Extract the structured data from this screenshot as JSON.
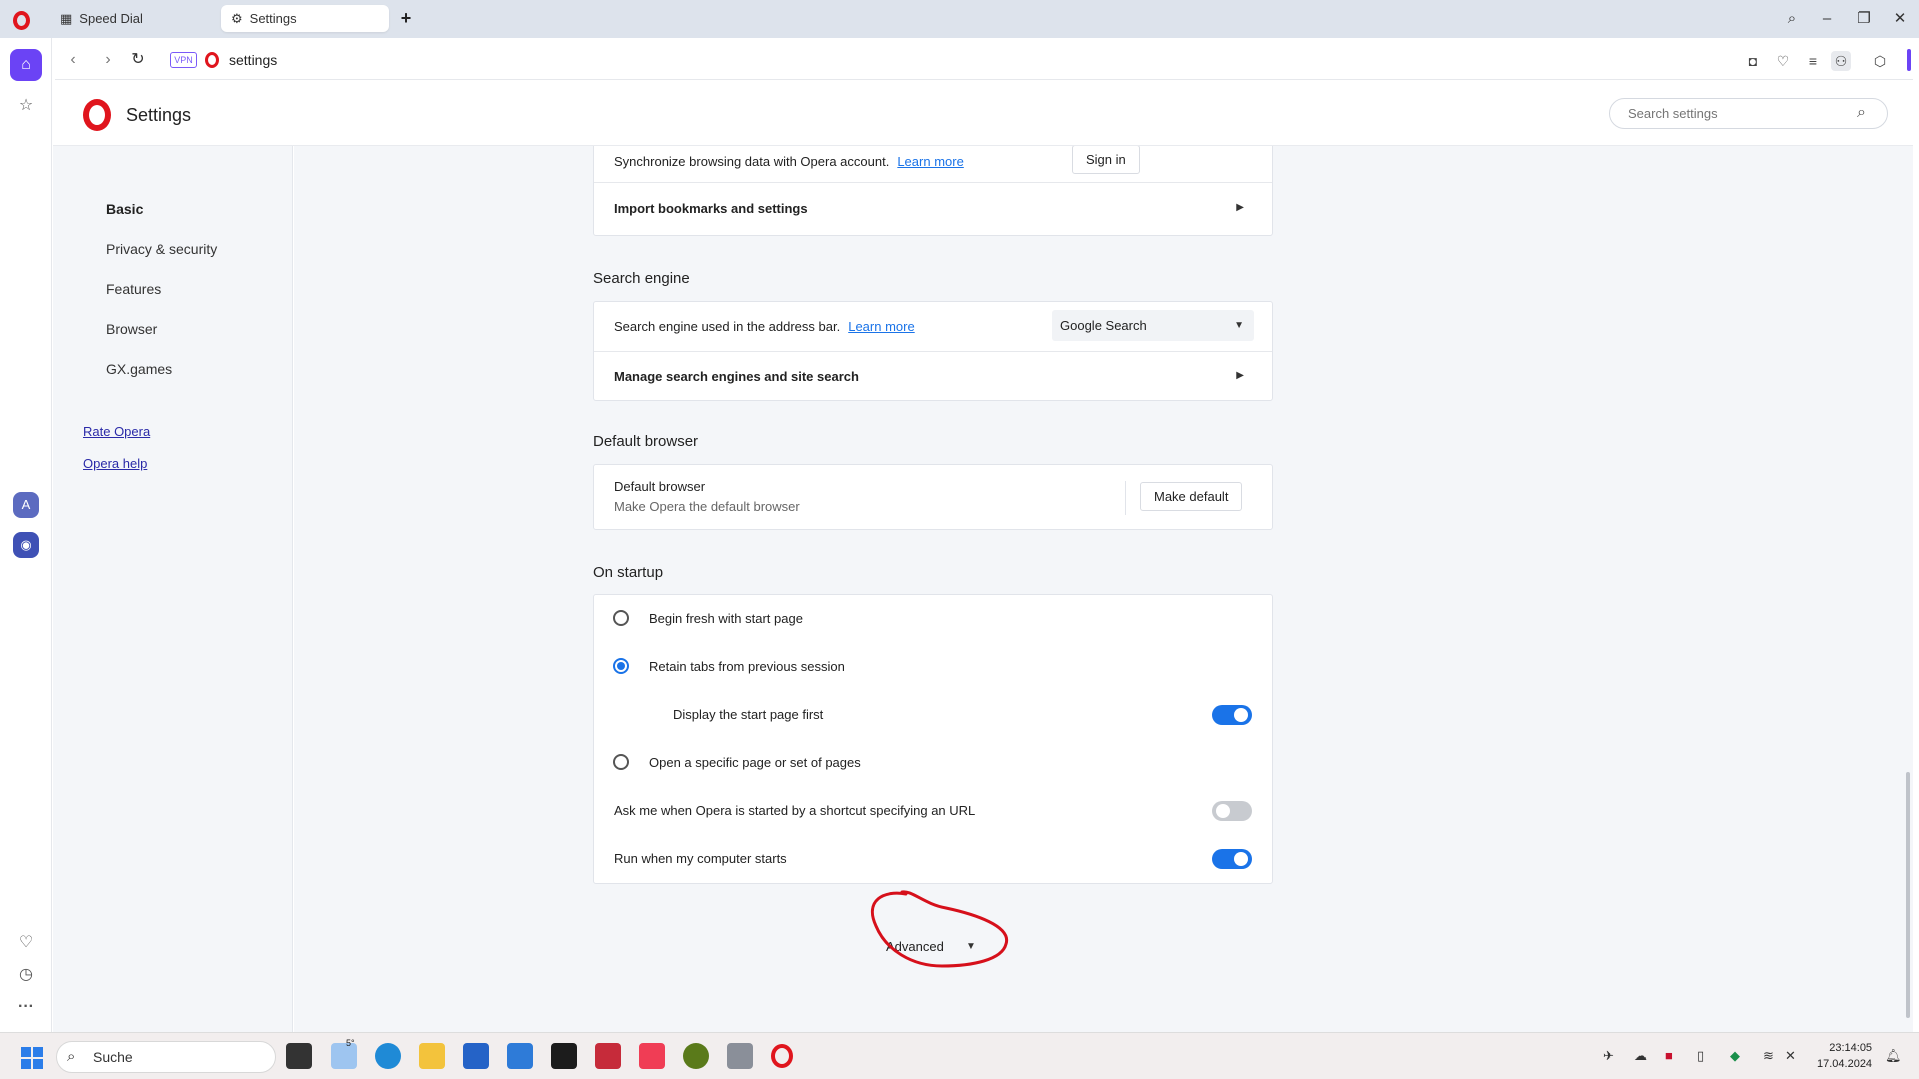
{
  "browser": {
    "tabs": [
      {
        "label": "Speed Dial",
        "icon": "grid-icon"
      },
      {
        "label": "Settings",
        "icon": "gear-icon"
      }
    ],
    "vpn_label": "VPN",
    "address": "settings"
  },
  "header": {
    "title": "Settings",
    "search_placeholder": "Search settings"
  },
  "nav": {
    "items": [
      "Basic",
      "Privacy & security",
      "Features",
      "Browser",
      "GX.games"
    ],
    "links": [
      "Rate Opera",
      "Opera help"
    ]
  },
  "sync": {
    "text": "Synchronize browsing data with Opera account.",
    "learn_more": "Learn more",
    "sign_in": "Sign in",
    "import": "Import bookmarks and settings"
  },
  "search_engine": {
    "title": "Search engine",
    "text": "Search engine used in the address bar.",
    "learn_more": "Learn more",
    "selected": "Google Search",
    "manage": "Manage search engines and site search"
  },
  "default_browser": {
    "title": "Default browser",
    "label": "Default browser",
    "sub": "Make Opera the default browser",
    "button": "Make default"
  },
  "startup": {
    "title": "On startup",
    "options": [
      "Begin fresh with start page",
      "Retain tabs from previous session",
      "Display the start page first",
      "Open a specific page or set of pages",
      "Ask me when Opera is started by a shortcut specifying an URL",
      "Run when my computer starts"
    ]
  },
  "advanced": "Advanced",
  "taskbar": {
    "search": "Suche",
    "weather": "5°",
    "time": "23:14:05",
    "date": "17.04.2024"
  },
  "colors": {
    "accent": "#1a73e8",
    "opera_red": "#e0151d",
    "sidebar_accent": "#6b43f5",
    "annotation": "#d6101b"
  }
}
